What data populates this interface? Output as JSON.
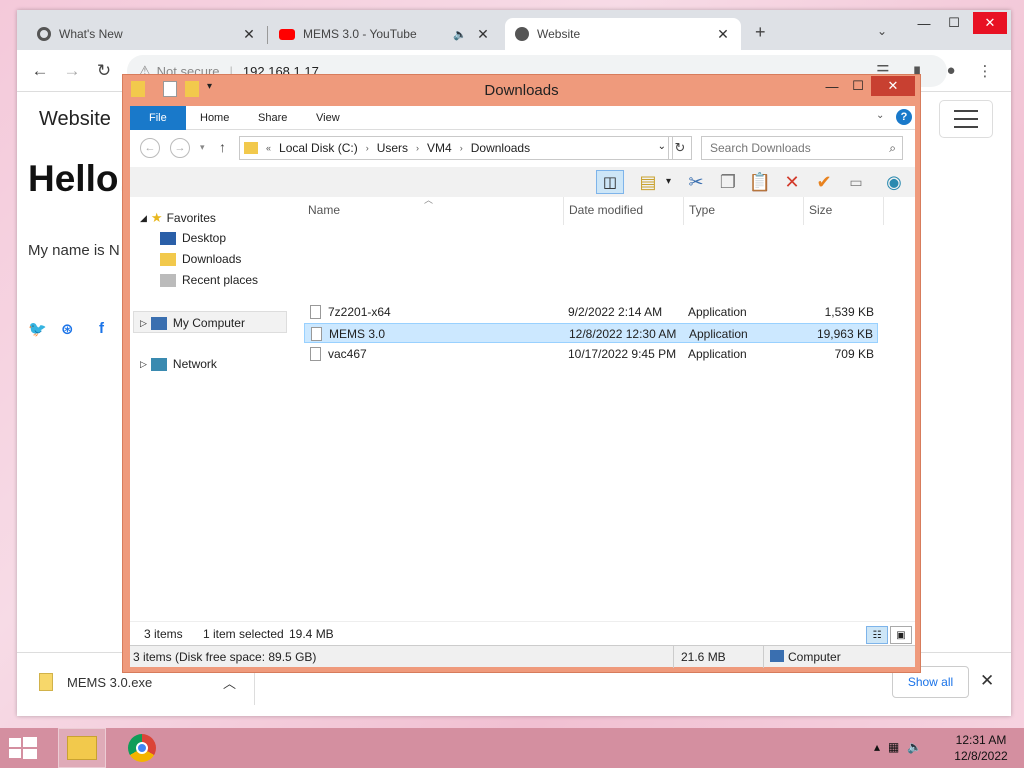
{
  "browser": {
    "tabs": [
      {
        "title": "What's New",
        "icon": "chrome-icon"
      },
      {
        "title": "MEMS 3.0 - YouTube",
        "icon": "youtube-icon"
      },
      {
        "title": "Website",
        "icon": "globe-icon"
      }
    ],
    "new_tab": "+",
    "omnibox": {
      "security": "Not secure",
      "url": "192.168.1.17"
    }
  },
  "website": {
    "brand": "Website",
    "heading": "Hello!",
    "intro": "My name is N",
    "social": [
      "twitter-icon",
      "dribbble-icon",
      "facebook-icon"
    ]
  },
  "download_bar": {
    "file": "MEMS 3.0.exe",
    "show_all": "Show all"
  },
  "explorer": {
    "title": "Downloads",
    "ribbon_tabs": [
      "File",
      "Home",
      "Share",
      "View"
    ],
    "breadcrumb": [
      "Local Disk (C:)",
      "Users",
      "VM4",
      "Downloads"
    ],
    "search_placeholder": "Search Downloads",
    "nav": {
      "favorites": "Favorites",
      "favorites_items": [
        "Desktop",
        "Downloads",
        "Recent places"
      ],
      "my_computer": "My Computer",
      "network": "Network"
    },
    "columns": [
      "Name",
      "Date modified",
      "Type",
      "Size"
    ],
    "files": [
      {
        "name": "7z2201-x64",
        "date": "9/2/2022 2:14 AM",
        "type": "Application",
        "size": "1,539 KB",
        "selected": false
      },
      {
        "name": "MEMS 3.0",
        "date": "12/8/2022 12:30 AM",
        "type": "Application",
        "size": "19,963 KB",
        "selected": true
      },
      {
        "name": "vac467",
        "date": "10/17/2022 9:45 PM",
        "type": "Application",
        "size": "709 KB",
        "selected": false
      }
    ],
    "status": {
      "items": "3 items",
      "selected": "1 item selected",
      "selected_size": "19.4 MB"
    },
    "infobar": {
      "summary": "3 items (Disk free space: 89.5 GB)",
      "size": "21.6 MB",
      "location": "Computer"
    }
  },
  "taskbar": {
    "time": "12:31 AM",
    "date": "12/8/2022"
  }
}
